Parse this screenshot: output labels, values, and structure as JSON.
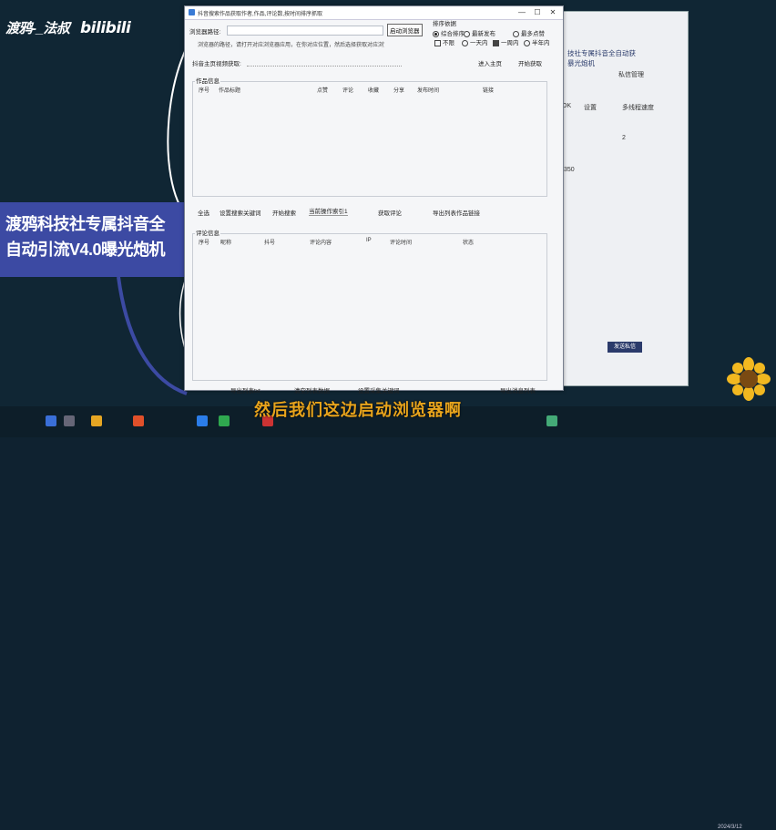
{
  "watermark": {
    "name": "渡鸦-_法叔",
    "brand": "bilibili"
  },
  "topic": {
    "line1": "渡鸦科技社专属抖音全",
    "line2": "自动引流V4.0曝光炮机"
  },
  "window": {
    "title": "抖音搜索作品获取作者,作品,评论数,按时间排序抓取",
    "controls": {
      "minimize": "—",
      "maximize": "☐",
      "close": "✕"
    },
    "browser_path_label": "浏览器路径:",
    "start_browser": "启动浏览器",
    "sort_title": "排序依据",
    "sort_options": [
      {
        "label": "综合排序",
        "checked": true
      },
      {
        "label": "最新发布",
        "checked": false
      },
      {
        "label": "最多点赞",
        "checked": false
      }
    ],
    "time_options": [
      {
        "label": "不限",
        "checked": false
      },
      {
        "label": "一天内",
        "checked": false
      },
      {
        "label": "一周内",
        "checked": true
      },
      {
        "label": "半年内",
        "checked": false
      }
    ],
    "tip": "浏览器的路径，请打开对应浏览器应用，在你对应位置，然后选择获取对应浏览器",
    "homepage_label": "抖音主页视频获取:",
    "enter_homepage": "进入主页",
    "start_fetch": "开始获取",
    "works_group": "作品信息",
    "works_columns": [
      "序号",
      "作品标题",
      "点赞",
      "评论",
      "收藏",
      "分享",
      "发布时间",
      "链接"
    ],
    "actions1": [
      "全选",
      "设置搜索关键词",
      "开始搜索",
      "当前操作索引1",
      "获取评论",
      "导出列表作品链接"
    ],
    "comments_group": "评论信息",
    "comments_columns": [
      "序号",
      "昵称",
      "抖号",
      "评论内容",
      "IP",
      "评论时间",
      "状态"
    ],
    "actions2": [
      "导出列表txt",
      "清空列表数据",
      "设置采集关键词",
      "导出消息列表"
    ]
  },
  "side_window": {
    "title1": "技社专属抖音全自动获",
    "title2": "暴光炮机",
    "items": [
      "私信管理",
      "OK",
      "设置",
      "多线程速度",
      "2",
      "0",
      "350",
      "发送私信"
    ],
    "button": "发送私信"
  },
  "caption": "然后我们这边启动浏览器啊",
  "clock": "2024/3/12",
  "colors": {
    "topic": "#3c4aa3",
    "caption": "#e8a41c",
    "bg": "#102634"
  }
}
